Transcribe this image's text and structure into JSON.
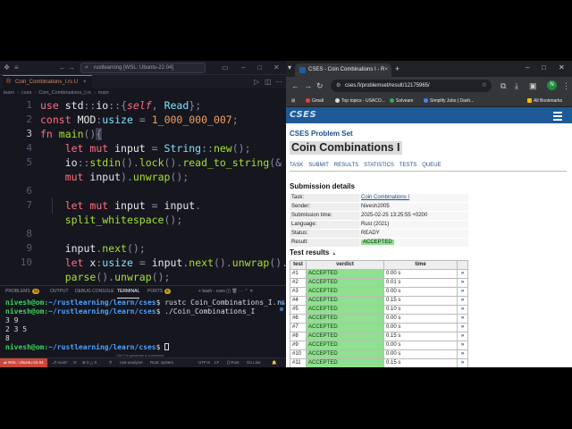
{
  "vscode": {
    "title_search": "rustlearning [WSL: Ubuntu-22.04]",
    "tab_label": "Coin_Combinations_I.rs",
    "tab_status": "U",
    "breadcrumb": [
      "learn",
      "cses",
      "Coin_Combinations_I.rs",
      "main"
    ],
    "line_numbers": [
      "1",
      "2",
      "3",
      "4",
      "5",
      "",
      "6",
      "7",
      "",
      "8",
      "9",
      "10",
      ""
    ],
    "terminal": {
      "tabs": [
        "PROBLEMS",
        "OUTPUT",
        "DEBUG CONSOLE",
        "TERMINAL",
        "PORTS"
      ],
      "problems_count": "11",
      "ports_count": "6",
      "shell_label": "bash - cses",
      "lines": [
        {
          "prompt": "nivesh@om:",
          "path": "~/rustlearning/learn/cses",
          "cmd": "$ rustc Coin_Combinations_I.rs"
        },
        {
          "prompt": "nivesh@om:",
          "path": "~/rustlearning/learn/cses",
          "cmd": "$ ./Coin_Combinations_I"
        },
        {
          "text": "3 9"
        },
        {
          "text": "2 3 5"
        },
        {
          "text": "8"
        },
        {
          "prompt": "nivesh@om:",
          "path": "~/rustlearning/learn/cses",
          "cmd": "$ "
        }
      ],
      "hint": "Ctrl+I to generate a command"
    },
    "status": {
      "remote": "WSL: Ubuntu-22.04",
      "branch": "main*",
      "errors": "0 △ 0",
      "position": "Ln 3, Col 16",
      "items": [
        "rust-analyzer",
        "Rust: system",
        "UTF-8",
        "LF",
        "Rust",
        "Go Live"
      ]
    }
  },
  "chrome": {
    "tab_title": "CSES - Coin Combinations I - R",
    "url": "cses.fi/problemset/result/12175965/",
    "avatar_letter": "N",
    "bookmarks": [
      "Gmail",
      "Top topics - USACO...",
      "Solveam",
      "Simplify Jobs | Dash...",
      "All Bookmarks"
    ]
  },
  "cses": {
    "logo": "CSES",
    "problem_set": "CSES Problem Set",
    "task_title": "Coin Combinations I",
    "subnav": [
      "TASK",
      "SUBMIT",
      "RESULTS",
      "STATISTICS",
      "TESTS",
      "QUEUE"
    ],
    "submission_heading": "Submission details",
    "details": [
      {
        "key": "Task:",
        "value": "Coin Combinations I"
      },
      {
        "key": "Sender:",
        "value": "Nivesh2005"
      },
      {
        "key": "Submission time:",
        "value": "2025-02-25 13:25:55 +0200"
      },
      {
        "key": "Language:",
        "value": "Rust (2021)"
      },
      {
        "key": "Status:",
        "value": "READY"
      },
      {
        "key": "Result:",
        "value": "ACCEPTED"
      }
    ],
    "tests_heading": "Test results",
    "tests_headers": [
      "test",
      "verdict",
      "time"
    ],
    "tests": [
      {
        "n": "#1",
        "verdict": "ACCEPTED",
        "time": "0.00 s"
      },
      {
        "n": "#2",
        "verdict": "ACCEPTED",
        "time": "0.01 s"
      },
      {
        "n": "#3",
        "verdict": "ACCEPTED",
        "time": "0.00 s"
      },
      {
        "n": "#4",
        "verdict": "ACCEPTED",
        "time": "0.15 s"
      },
      {
        "n": "#5",
        "verdict": "ACCEPTED",
        "time": "0.10 s"
      },
      {
        "n": "#6",
        "verdict": "ACCEPTED",
        "time": "0.00 s"
      },
      {
        "n": "#7",
        "verdict": "ACCEPTED",
        "time": "0.00 s"
      },
      {
        "n": "#8",
        "verdict": "ACCEPTED",
        "time": "0.15 s"
      },
      {
        "n": "#9",
        "verdict": "ACCEPTED",
        "time": "0.00 s"
      },
      {
        "n": "#10",
        "verdict": "ACCEPTED",
        "time": "0.00 s"
      },
      {
        "n": "#11",
        "verdict": "ACCEPTED",
        "time": "0.15 s"
      }
    ]
  }
}
